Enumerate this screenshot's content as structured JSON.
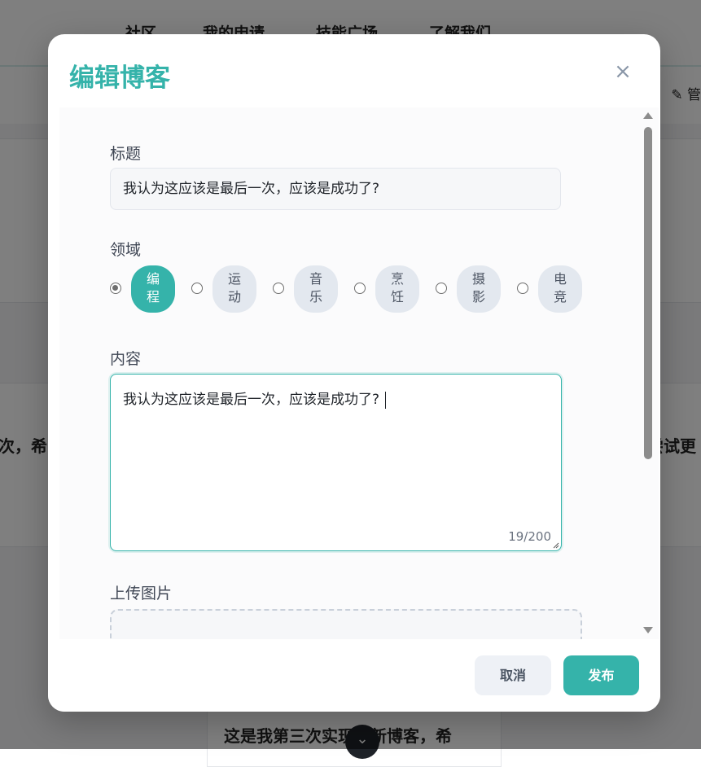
{
  "background": {
    "nav": [
      "社区",
      "我的申请",
      "技能广场",
      "了解我们"
    ],
    "manage_label": "✎ 管",
    "card_left_text": "次，希",
    "card_right_text": "尝试更",
    "card_bottom_text": "这是我第三次实现更新博客，希",
    "scroll_down_icon": "chevron-down-icon"
  },
  "modal": {
    "title": "编辑博客",
    "close_glyph": "×",
    "title_label": "标题",
    "title_value": "我认为这应该是最后一次，应该是成功了?",
    "field_label": "领域",
    "fields": [
      {
        "label": "编程",
        "line1": "编",
        "line2": "程",
        "selected": true
      },
      {
        "label": "运动",
        "line1": "运",
        "line2": "动",
        "selected": false
      },
      {
        "label": "音乐",
        "line1": "音",
        "line2": "乐",
        "selected": false
      },
      {
        "label": "烹饪",
        "line1": "烹",
        "line2": "饪",
        "selected": false
      },
      {
        "label": "摄影",
        "line1": "摄",
        "line2": "影",
        "selected": false
      },
      {
        "label": "电竞",
        "line1": "电",
        "line2": "竞",
        "selected": false
      }
    ],
    "content_label": "内容",
    "content_value": "我认为这应该是最后一次，应该是成功了?",
    "content_counter": "19/200",
    "upload_label": "上传图片",
    "cancel_label": "取消",
    "publish_label": "发布",
    "accent_color": "#35b3aa"
  }
}
